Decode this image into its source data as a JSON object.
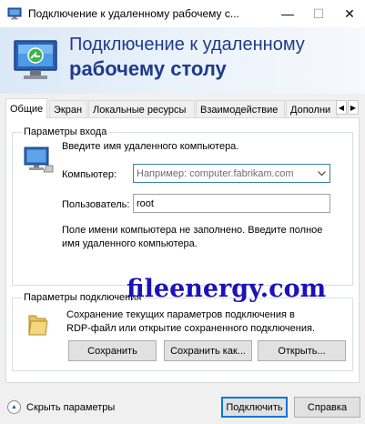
{
  "window": {
    "title": "Подключение к удаленному рабочему с...",
    "minimize_glyph": "—",
    "maximize_glyph": "☐",
    "close_glyph": "✕",
    "app_icon": "remote-desktop-icon"
  },
  "banner": {
    "line1": "Подключение к удаленному",
    "line2": "рабочему столу",
    "icon": "remote-desktop-icon"
  },
  "tabs": [
    {
      "label": "Общие",
      "active": true
    },
    {
      "label": "Экран",
      "active": false
    },
    {
      "label": "Локальные ресурсы",
      "active": false
    },
    {
      "label": "Взаимодействие",
      "active": false
    },
    {
      "label": "Дополни",
      "active": false
    }
  ],
  "tab_scroll": {
    "left": "◀",
    "right": "▶"
  },
  "login": {
    "legend": "Параметры входа",
    "prompt": "Введите имя удаленного компьютера.",
    "computer_label": "Компьютер:",
    "computer_placeholder": "Например: computer.fabrikam.com",
    "user_label": "Пользователь:",
    "user_value": "root",
    "note_line1": "Поле имени компьютера не заполнено. Введите полное",
    "note_line2": "имя удаленного компьютера.",
    "icon": "computer-icon"
  },
  "connection": {
    "legend": "Параметры подключения",
    "desc_line1": "Сохранение текущих параметров подключения в",
    "desc_line2": "RDP-файл или открытие сохраненного подключения.",
    "save": "Сохранить",
    "save_as": "Сохранить как...",
    "open": "Открыть...",
    "icon": "folder-icon"
  },
  "watermark": "fileenergy.com",
  "footer": {
    "hide_options": "Скрыть параметры",
    "connect": "Подключить",
    "help": "Справка"
  },
  "colors": {
    "banner_text": "#1f3b8a",
    "watermark": "#1b12b8",
    "accent": "#0078d7"
  }
}
